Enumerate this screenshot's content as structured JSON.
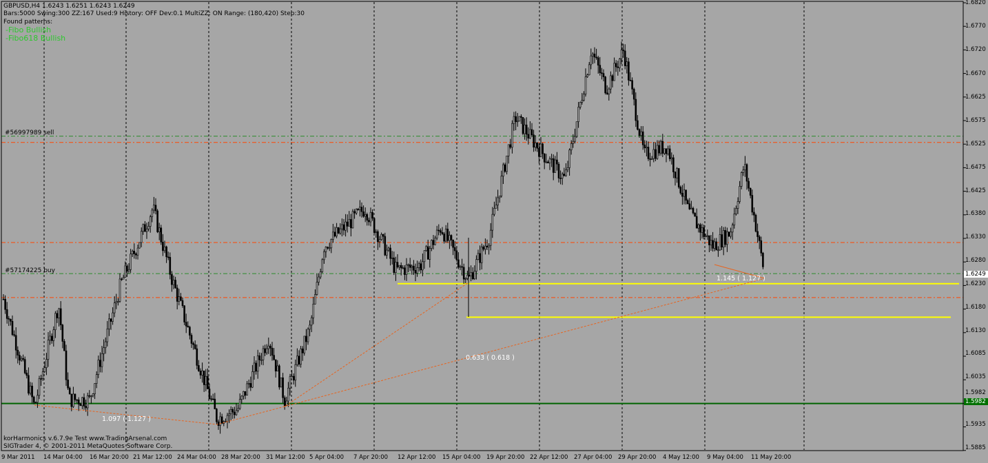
{
  "header": {
    "line1": "GBPUSD,H4  1.6243 1.6251 1.6243 1.6249",
    "line2": "Bars:5000  Swing:300  ZZ:167  Used:9  History: OFF Dev:0.1  MultiZZ: ON  Range: (180,420)  Step:30",
    "found_label": "Found patterns:",
    "patterns": [
      "-Fibo Bullish",
      "-Fibo618 Bullish"
    ]
  },
  "orders": {
    "sell_label": "#56997989 sell",
    "buy_label": "#57174225 buy"
  },
  "footer": {
    "line1": "korHarmonics v.6.7.9e Test www.TradingArsenal.com",
    "line2": "SIGTrader 4, © 2001-2011 MetaQuotes Software Corp."
  },
  "fibo_labels": {
    "a": "1.097 ( 1.127 )",
    "b": "0.633 ( 0.618 )",
    "c": "1.145 ( 1.127 )"
  },
  "price_axis": {
    "ticks": [
      "1.6820",
      "1.6770",
      "1.6720",
      "1.6670",
      "1.6625",
      "1.6575",
      "1.6525",
      "1.6475",
      "1.6425",
      "1.6380",
      "1.6330",
      "1.6280",
      "1.6230",
      "1.6180",
      "1.6130",
      "1.6085",
      "1.6035",
      "1.5982",
      "1.5935",
      "1.5885"
    ],
    "current_price": "1.6249",
    "support_price": "1.5982"
  },
  "time_axis": {
    "labels": [
      "9 Mar 2011",
      "14 Mar 04:00",
      "16 Mar 20:00",
      "21 Mar 12:00",
      "24 Mar 04:00",
      "28 Mar 20:00",
      "31 Mar 12:00",
      "5 Apr 04:00",
      "7 Apr 20:00",
      "12 Apr 12:00",
      "15 Apr 04:00",
      "19 Apr 20:00",
      "22 Apr 12:00",
      "27 Apr 04:00",
      "29 Apr 20:00",
      "4 May 12:00",
      "9 May 04:00",
      "11 May 20:00"
    ]
  },
  "colors": {
    "background": "#a6a6a6",
    "candle": "#000000",
    "grid": "#000000",
    "order_line": "#2e8b2e",
    "orange_line": "#ff4500",
    "pattern_line": "#e8641e",
    "yellow_line": "#ffff00",
    "support_line": "#006400",
    "pattern_text": "#2ec72e"
  },
  "chart_data": {
    "type": "candlestick",
    "symbol": "GBPUSD",
    "timeframe": "H4",
    "ylim": [
      1.5885,
      1.682
    ],
    "key_points": [
      {
        "x": "9 Mar 2011",
        "y": 1.62
      },
      {
        "x": "14 Mar 04:00",
        "y": 1.597
      },
      {
        "x": "21 Mar 12:00",
        "y": 1.64
      },
      {
        "x": "28 Mar 20:00",
        "y": 1.595
      },
      {
        "x": "7 Apr 20:00",
        "y": 1.641
      },
      {
        "x": "15 Apr 04:00",
        "y": 1.617
      },
      {
        "x": "19 Apr 20:00",
        "y": 1.659
      },
      {
        "x": "27 Apr 04:00",
        "y": 1.674
      },
      {
        "x": "29 Apr 20:00",
        "y": 1.673
      },
      {
        "x": "4 May 12:00",
        "y": 1.645
      },
      {
        "x": "9 May 04:00",
        "y": 1.627
      },
      {
        "x": "11 May 20:00",
        "y": 1.6249
      }
    ],
    "horizontal_levels": [
      {
        "name": "#56997989 sell",
        "y": 1.654,
        "style": "green dash-dot"
      },
      {
        "name": "",
        "y": 1.6527,
        "style": "orange dash-dot"
      },
      {
        "name": "",
        "y": 1.6318,
        "style": "orange dash-dot"
      },
      {
        "name": "#57174225 buy",
        "y": 1.6253,
        "style": "green dash-dot"
      },
      {
        "name": "",
        "y": 1.6232,
        "style": "yellow solid"
      },
      {
        "name": "",
        "y": 1.6203,
        "style": "orange dash-dot"
      },
      {
        "name": "",
        "y": 1.6162,
        "style": "yellow solid"
      },
      {
        "name": "",
        "y": 1.5982,
        "style": "dark green solid"
      }
    ]
  }
}
